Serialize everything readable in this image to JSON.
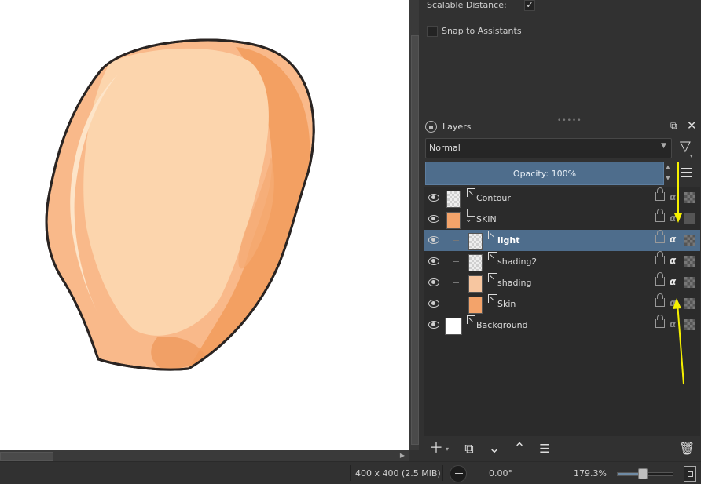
{
  "tool_options": {
    "scalable_distance_label": "Scalable Distance:",
    "scalable_distance_checked": "✓",
    "snap_label": "Snap to Assistants"
  },
  "layers_docker": {
    "title": "Layers",
    "blend_mode": "Normal",
    "opacity_label": "Opacity:  100%",
    "layers": [
      {
        "name": "Contour",
        "type": "paint",
        "visible": true,
        "alpha_inherit": false
      },
      {
        "name": "SKIN",
        "type": "group",
        "expanded": true,
        "visible": true
      },
      {
        "name": "light",
        "type": "paint",
        "selected": true,
        "visible": true,
        "alpha_inherit": true,
        "parent": "SKIN"
      },
      {
        "name": "shading2",
        "type": "paint",
        "visible": true,
        "alpha_inherit": true,
        "parent": "SKIN"
      },
      {
        "name": "shading",
        "type": "paint",
        "visible": true,
        "alpha_inherit": true,
        "parent": "SKIN"
      },
      {
        "name": "Skin",
        "type": "paint",
        "visible": true,
        "alpha_inherit": false,
        "parent": "SKIN"
      },
      {
        "name": "Background",
        "type": "paint",
        "visible": true,
        "alpha_inherit": false
      }
    ],
    "alpha_glyph": "α"
  },
  "status_bar": {
    "image_size": "400 x 400 (2.5 MiB)",
    "rotation": "0.00°",
    "zoom": "179.3%",
    "zoom_level": 0.43
  },
  "colors": {
    "selection": "#4e6d8c",
    "annotation_arrow": "#f5f000",
    "skin_base": "#f9b98a",
    "skin_shade": "#f3a062",
    "skin_light": "#fcd5ad"
  },
  "icons": [
    "eye-icon",
    "paint-layer-icon",
    "group-layer-icon",
    "lock-icon",
    "alpha-inherit-icon",
    "inherit-checker-icon",
    "filter-icon",
    "menu-icon",
    "add-icon",
    "duplicate-icon",
    "move-down-icon",
    "move-up-icon",
    "properties-icon",
    "trash-icon",
    "float-icon",
    "close-icon"
  ]
}
